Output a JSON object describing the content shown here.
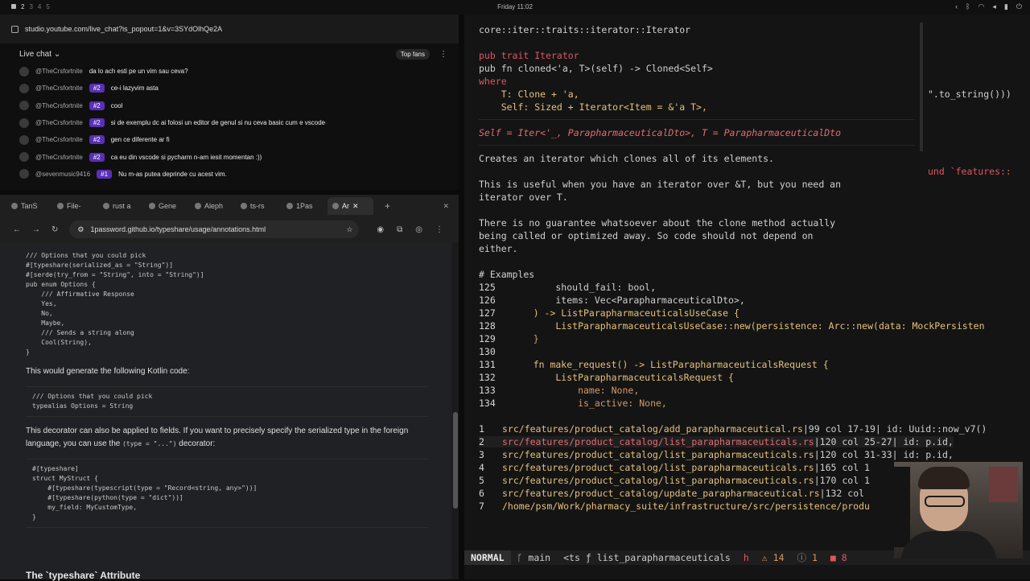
{
  "topbar": {
    "workspaces": [
      "2",
      "3",
      "4",
      "5"
    ],
    "clock": "Friday 11:02"
  },
  "chat": {
    "url": "studio.youtube.com/live_chat?is_popout=1&v=3SYdOlhQe2A",
    "title": "Live chat",
    "top_fans": "Top fans",
    "messages": [
      {
        "user": "@TheCrsfortnite",
        "badge": "",
        "text": "da lo ach esti pe un vim sau ceva?"
      },
      {
        "user": "@TheCrsfortnite",
        "badge": "#2",
        "text": "ce-i lazyvim asta"
      },
      {
        "user": "@TheCrsfortnite",
        "badge": "#2",
        "text": "cool"
      },
      {
        "user": "@TheCrsfortnite",
        "badge": "#2",
        "text": "si de exemplu dc ai folosi un editor de genul si nu ceva basic cum e vscode"
      },
      {
        "user": "@TheCrsfortnite",
        "badge": "#2",
        "text": "gen ce diferente ar fi"
      },
      {
        "user": "@TheCrsfortnite",
        "badge": "#2",
        "text": "ca eu din vscode si pycharm n-am iesit momentan :))"
      },
      {
        "user": "@sevenmusic9416",
        "badge": "#1",
        "text": "Nu m-as putea deprinde cu acest vim."
      }
    ]
  },
  "browser": {
    "tabs": [
      "TanS",
      "File-",
      "rust a",
      "Gene",
      "Aleph",
      "ts-rs",
      "1Pas",
      "Ar"
    ],
    "url": "1password.github.io/typeshare/usage/annotations.html"
  },
  "doc": {
    "code1": "/// Options that you could pick\n#[typeshare(serialized_as = \"String\")]\n#[serde(try_from = \"String\", into = \"String\")]\npub enum Options {\n    /// Affirmative Response\n    Yes,\n    No,\n    Maybe,\n    /// Sends a string along\n    Cool(String),\n}",
    "para1": "This would generate the following Kotlin code:",
    "code2": "/// Options that you could pick\ntypealias Options = String",
    "para2_a": "This decorator can also be applied to fields. If you want to precisely specify the serialized type in the foreign language, you can use the ",
    "para2_code": "(type = \"...\")",
    "para2_b": " decorator:",
    "code3": "#[typeshare]\nstruct MyStruct {\n    #[typeshare(typescript(type = \"Record<string, any>\"))]\n    #[typeshare(python(type = \"dict\"))]\n    my_field: MyCustomType,\n}",
    "next_heading": "The `typeshare` Attribute"
  },
  "editor": {
    "hover_title": "core::iter::traits::iterator::Iterator",
    "sig1": "pub trait Iterator",
    "sig2": "pub fn cloned<'a, T>(self) -> Cloned<Self>",
    "sig3": "where",
    "sig4": "    T: Clone + 'a,",
    "sig5": "    Self: Sized + Iterator<Item = &'a T>,",
    "selfline": "Self = Iter<'_, ParapharmaceuticalDto>, T = ParapharmaceuticalDto",
    "desc1": "Creates an iterator which clones all of its elements.",
    "desc2": "This is useful when you have an iterator over &T, but you need an",
    "desc3": "iterator over T.",
    "desc4": "There is no guarantee whatsoever about the clone method actually",
    "desc5": "being called or optimized away. So code should not depend on",
    "desc6": "either.",
    "examples": "# Examples",
    "right_fragment1": "\".to_string()))",
    "right_fragment2": "und `features::",
    "lines": [
      {
        "n": "125",
        "code": "        should_fail: bool,"
      },
      {
        "n": "126",
        "code": "        items: Vec<ParapharmaceuticalDto>,"
      },
      {
        "n": "127",
        "code": "    ) -> ListParapharmaceuticalsUseCase {"
      },
      {
        "n": "128",
        "code": "        ListParapharmaceuticalsUseCase::new(persistence: Arc::new(data: MockPersisten"
      },
      {
        "n": "129",
        "code": "    }"
      },
      {
        "n": "130",
        "code": ""
      },
      {
        "n": "131",
        "code": "    fn make_request() -> ListParapharmaceuticalsRequest {"
      },
      {
        "n": "132",
        "code": "        ListParapharmaceuticalsRequest {"
      },
      {
        "n": "133",
        "code": "            name: None,"
      },
      {
        "n": "134",
        "code": "            is_active: None,"
      }
    ],
    "quickfix": [
      {
        "n": "1",
        "path": "src/features/product_catalog/add_parapharmaceutical.rs",
        "pos": "|99 col 17-19| id: Uuid::now_v7()"
      },
      {
        "n": "2",
        "path": "src/features/product_catalog/list_parapharmaceuticals.rs",
        "pos": "|120 col 25-27| id: p.id,"
      },
      {
        "n": "3",
        "path": "src/features/product_catalog/list_parapharmaceuticals.rs",
        "pos": "|120 col 31-33| id: p.id,"
      },
      {
        "n": "4",
        "path": "src/features/product_catalog/list_parapharmaceuticals.rs",
        "pos": "|165 col 1"
      },
      {
        "n": "5",
        "path": "src/features/product_catalog/list_parapharmaceuticals.rs",
        "pos": "|170 col 1"
      },
      {
        "n": "6",
        "path": "src/features/product_catalog/update_parapharmaceutical.rs",
        "pos": "|132 col"
      },
      {
        "n": "7",
        "path": "/home/psm/Work/pharmacy_suite/infrastructure/src/persistence/produ",
        "pos": ""
      }
    ],
    "status": {
      "mode": "NORMAL",
      "branch": "main",
      "crumb1": "<ts",
      "crumb2": "list_parapharmaceuticals",
      "hint": "h",
      "warnings": "14",
      "infos": "1",
      "errors": "8"
    }
  }
}
